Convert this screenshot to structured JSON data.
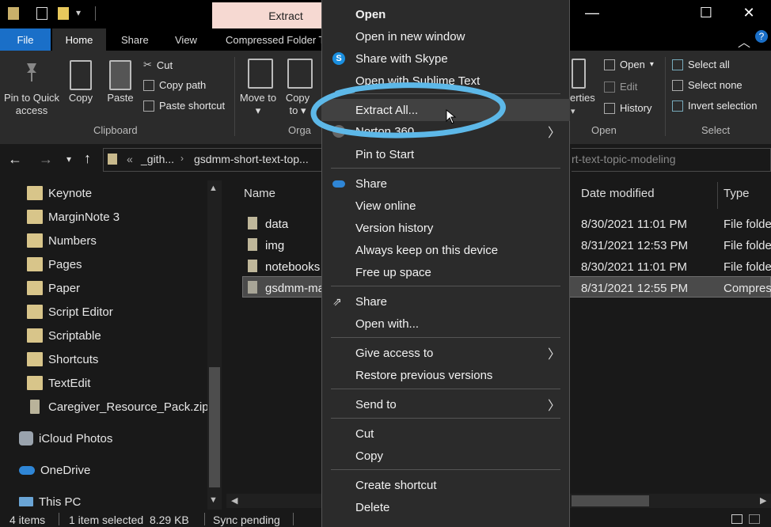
{
  "titlebar": {
    "active_tab": "Extract",
    "minimize": "—",
    "maximize": "☐",
    "close": "✕"
  },
  "ribbon_tabs": [
    "File",
    "Home",
    "Share",
    "View",
    "Compressed Folder T"
  ],
  "ribbon": {
    "pin_to_quick_access": "Pin to Quick access",
    "copy": "Copy",
    "paste": "Paste",
    "cut": "Cut",
    "copy_path": "Copy path",
    "paste_shortcut": "Paste shortcut",
    "clipboard_group": "Clipboard",
    "move_to": "Move to",
    "copy_to": "Copy to",
    "organize_group_partial": "Orga",
    "properties_partial": "erties",
    "open": "Open",
    "edit": "Edit",
    "history": "History",
    "open_group": "Open",
    "select_all": "Select all",
    "select_none": "Select none",
    "invert_selection": "Invert selection",
    "select_group": "Select"
  },
  "address": {
    "prefix": "«",
    "crumb1": "_gith...",
    "crumb2": "gsdmm-short-text-top...",
    "search_partial": "rt-text-topic-modeling"
  },
  "nav_pane": [
    "Keynote",
    "MarginNote 3",
    "Numbers",
    "Pages",
    "Paper",
    "Script Editor",
    "Scriptable",
    "Shortcuts",
    "TextEdit",
    "Caregiver_Resource_Pack.zip",
    "iCloud Photos",
    "OneDrive",
    "This PC"
  ],
  "file_list": {
    "headers": {
      "name": "Name",
      "date": "Date modified",
      "type": "Type"
    },
    "rows": [
      {
        "name": "data",
        "date": "8/30/2021 11:01 PM",
        "type": "File folde"
      },
      {
        "name": "img",
        "date": "8/31/2021 12:53 PM",
        "type": "File folde"
      },
      {
        "name": "notebooks",
        "date": "8/30/2021 11:01 PM",
        "type": "File folde"
      },
      {
        "name": "gsdmm-ma",
        "date": "8/31/2021 12:55 PM",
        "type": "Compres"
      }
    ]
  },
  "context_menu": {
    "open": "Open",
    "open_new_window": "Open in new window",
    "share_skype": "Share with Skype",
    "open_sublime": "Open with Sublime Text",
    "extract_all": "Extract All...",
    "norton": "Norton 360",
    "pin_start": "Pin to Start",
    "share_onedrive": "Share",
    "view_online": "View online",
    "version_history": "Version history",
    "always_keep": "Always keep on this device",
    "free_space": "Free up space",
    "share": "Share",
    "open_with": "Open with...",
    "give_access": "Give access to",
    "restore_versions": "Restore previous versions",
    "send_to": "Send to",
    "cut": "Cut",
    "copy": "Copy",
    "create_shortcut": "Create shortcut",
    "delete": "Delete"
  },
  "statusbar": {
    "items": "4 items",
    "selected": "1 item selected  8.29 KB",
    "sync": "Sync pending"
  },
  "colors": {
    "accent": "#1a6fc8",
    "highlight_circle": "#5db8e8",
    "menu_bg": "#2b2b2b"
  }
}
